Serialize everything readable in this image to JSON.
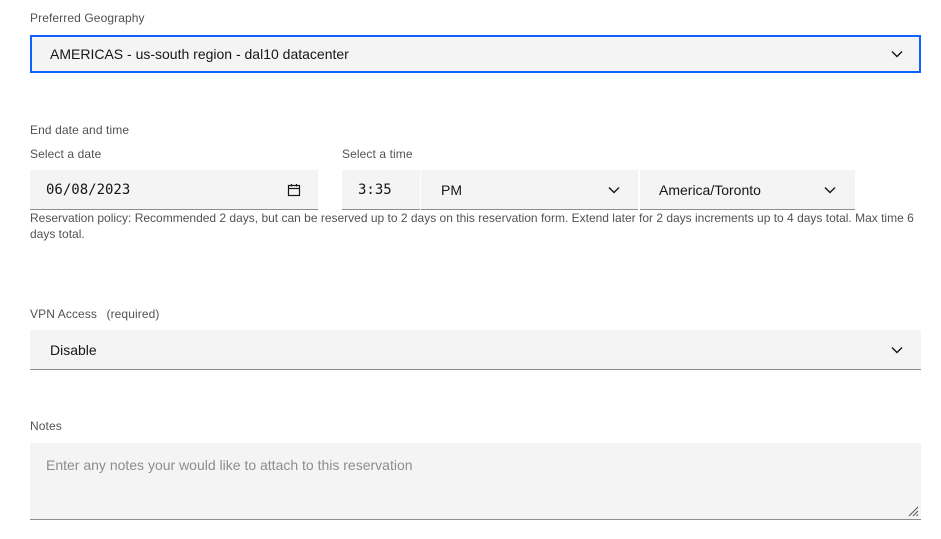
{
  "geography": {
    "label": "Preferred Geography",
    "value": "AMERICAS - us-south region - dal10 datacenter"
  },
  "end_date_time": {
    "label": "End date and time",
    "date_label": "Select a date",
    "date_value": "06/08/2023",
    "time_label": "Select a time",
    "time_value": "3:35",
    "ampm_value": "PM",
    "timezone_value": "America/Toronto",
    "policy_text": "Reservation policy: Recommended 2 days, but can be reserved up to 2 days on this reservation form. Extend later for 2 days increments up to 4 days total. Max time 6 days total."
  },
  "vpn": {
    "label": "VPN Access",
    "required": "(required)",
    "value": "Disable"
  },
  "notes": {
    "label": "Notes",
    "placeholder": "Enter any notes your would like to attach to this reservation"
  },
  "icons": {
    "chevron": "chevron-down-icon",
    "calendar": "calendar-icon",
    "resize": "resize-handle-icon"
  },
  "colors": {
    "focus": "#0f62fe",
    "field_bg": "#f4f4f4",
    "label": "#525252"
  }
}
